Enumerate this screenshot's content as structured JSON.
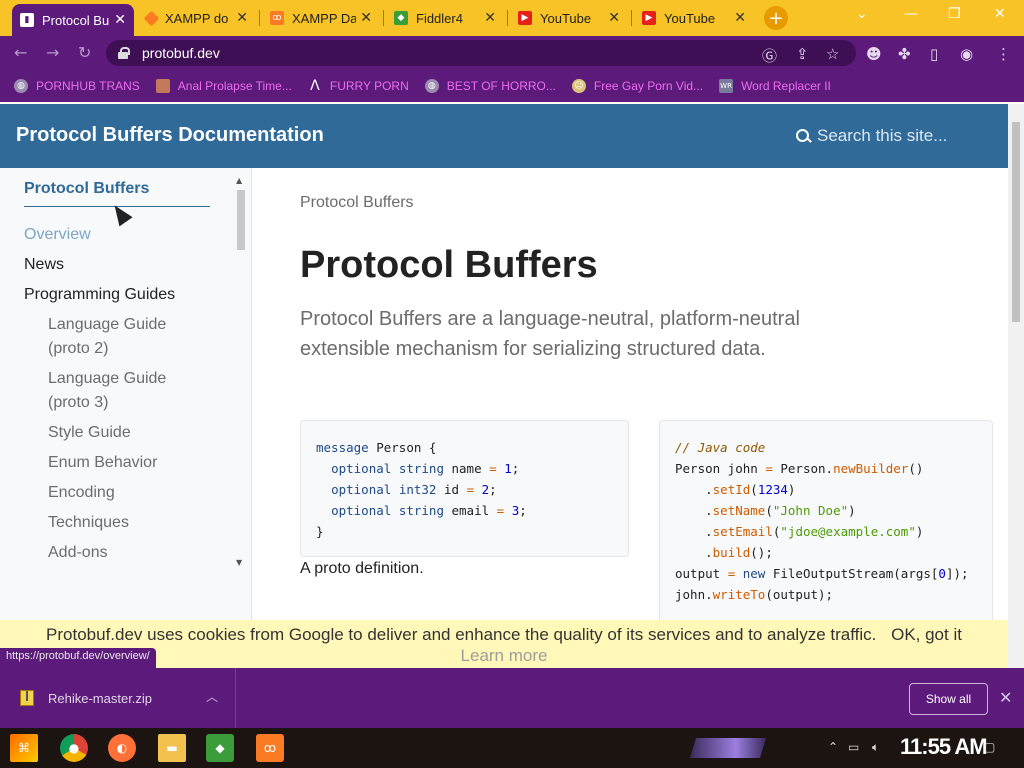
{
  "browser": {
    "tabs": [
      {
        "title": "Protocol Bu",
        "favicon": "protobuf-favicon",
        "active": true
      },
      {
        "title": "XAMPP do",
        "favicon": "xampp-favicon",
        "active": false
      },
      {
        "title": "XAMPP Da",
        "favicon": "xampp-favicon",
        "active": false
      },
      {
        "title": "Fiddler4",
        "favicon": "fiddler-favicon",
        "active": false
      },
      {
        "title": "YouTube",
        "favicon": "youtube-favicon",
        "active": false
      },
      {
        "title": "YouTube",
        "favicon": "youtube-favicon",
        "active": false
      }
    ],
    "url": "protobuf.dev",
    "bookmarks": [
      {
        "label": "PORNHUB TRANS",
        "icon": "globe-icon"
      },
      {
        "label": "Anal Prolapse Time...",
        "icon": "image-icon"
      },
      {
        "label": "FURRY PORN",
        "icon": "lambda-icon"
      },
      {
        "label": "BEST OF HORRO...",
        "icon": "globe-icon"
      },
      {
        "label": "Free Gay Porn Vid...",
        "icon": "mascot-icon"
      },
      {
        "label": "Word Replacer II",
        "icon": "wr-icon"
      }
    ],
    "status_url": "https://protobuf.dev/overview/"
  },
  "site": {
    "title": "Protocol Buffers Documentation",
    "search_placeholder": "Search this site..."
  },
  "sidebar": {
    "heading": "Protocol Buffers",
    "items": [
      {
        "label": "Overview",
        "level": 0,
        "active": true
      },
      {
        "label": "News",
        "level": 0
      },
      {
        "label": "Programming Guides",
        "level": 0
      },
      {
        "label": "Language Guide (proto 2)",
        "level": 1
      },
      {
        "label": "Language Guide (proto 3)",
        "level": 1
      },
      {
        "label": "Style Guide",
        "level": 1
      },
      {
        "label": "Enum Behavior",
        "level": 1
      },
      {
        "label": "Encoding",
        "level": 1
      },
      {
        "label": "Techniques",
        "level": 1
      },
      {
        "label": "Add-ons",
        "level": 1
      }
    ]
  },
  "main": {
    "breadcrumb": "Protocol Buffers",
    "title": "Protocol Buffers",
    "lead": "Protocol Buffers are a language-neutral, platform-neutral extensible mechanism for serializing structured data.",
    "proto_code": [
      "message Person {",
      "  optional string name = 1;",
      "  optional int32 id = 2;",
      "  optional string email = 3;",
      "}"
    ],
    "proto_caption": "A proto definition.",
    "java_code": [
      "// Java code",
      "Person john = Person.newBuilder()",
      "    .setId(1234)",
      "    .setName(\"John Doe\")",
      "    .setEmail(\"jdoe@example.com\")",
      "    .build();",
      "output = new FileOutputStream(args[0]);",
      "john.writeTo(output);"
    ]
  },
  "cookie": {
    "text": "Protobuf.dev uses cookies from Google to deliver and enhance the quality of its services and to analyze traffic.",
    "ok_label": "OK, got it",
    "learn_label": "Learn more"
  },
  "downloads": {
    "file": "Rehike-master.zip",
    "show_all": "Show all"
  },
  "taskbar": {
    "clock": "11:55 AM"
  },
  "colors": {
    "chrome_theme": "#5c1b7a",
    "tabstrip": "#f8c326",
    "site_header": "#2f6a98",
    "cookie_bar": "#fff8b8",
    "bookmark_text": "#ef6bf0"
  }
}
